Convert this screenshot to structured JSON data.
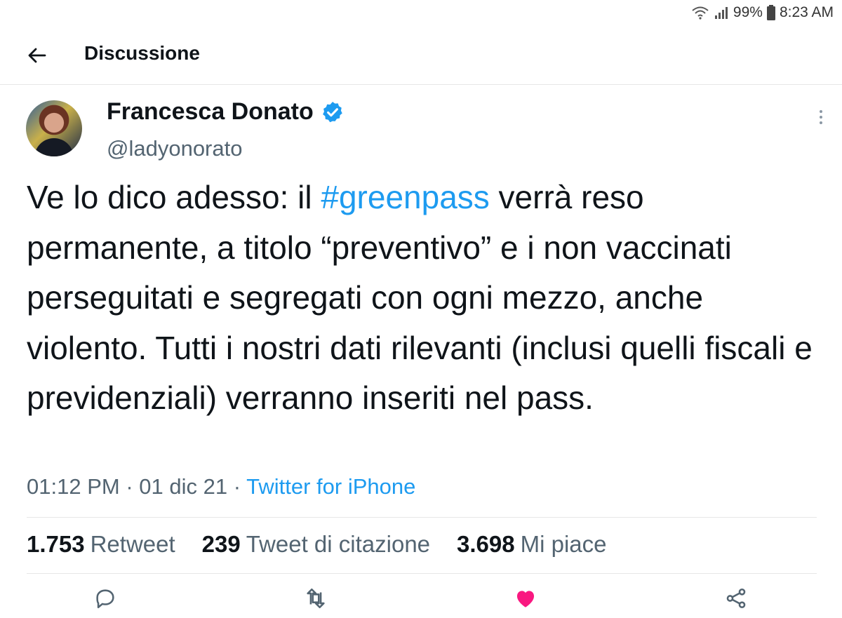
{
  "status_bar": {
    "battery": "99%",
    "time": "8:23 AM"
  },
  "header": {
    "title": "Discussione",
    "back_icon": "arrow-left-icon"
  },
  "author": {
    "name": "Francesca Donato",
    "handle": "@ladyonorato",
    "verified_color": "#1d9bf0"
  },
  "tweet": {
    "text_before": "Ve lo dico adesso: il ",
    "hashtag": "#greenpass",
    "text_after": " verrà reso permanente, a titolo “preventivo” e i non vaccinati perseguitati e segregati con ogni mezzo, anche violento. Tutti i nostri dati rilevanti (inclusi quelli fiscali e previdenziali) verranno inseriti nel pass."
  },
  "meta": {
    "time": "01:12 PM",
    "dot": "·",
    "date": "01 dic 21",
    "source": "Twitter for iPhone"
  },
  "stats": [
    {
      "count": "1.753",
      "label": "Retweet"
    },
    {
      "count": "239",
      "label": "Tweet di citazione"
    },
    {
      "count": "3.698",
      "label": "Mi piace"
    }
  ],
  "actions": {
    "icons": [
      "reply-icon",
      "retweet-icon",
      "like-icon",
      "share-icon"
    ],
    "like_color": "#f91880",
    "icon_color": "#536471"
  },
  "colors": {
    "link": "#1d9bf0",
    "secondary_text": "#536471"
  }
}
